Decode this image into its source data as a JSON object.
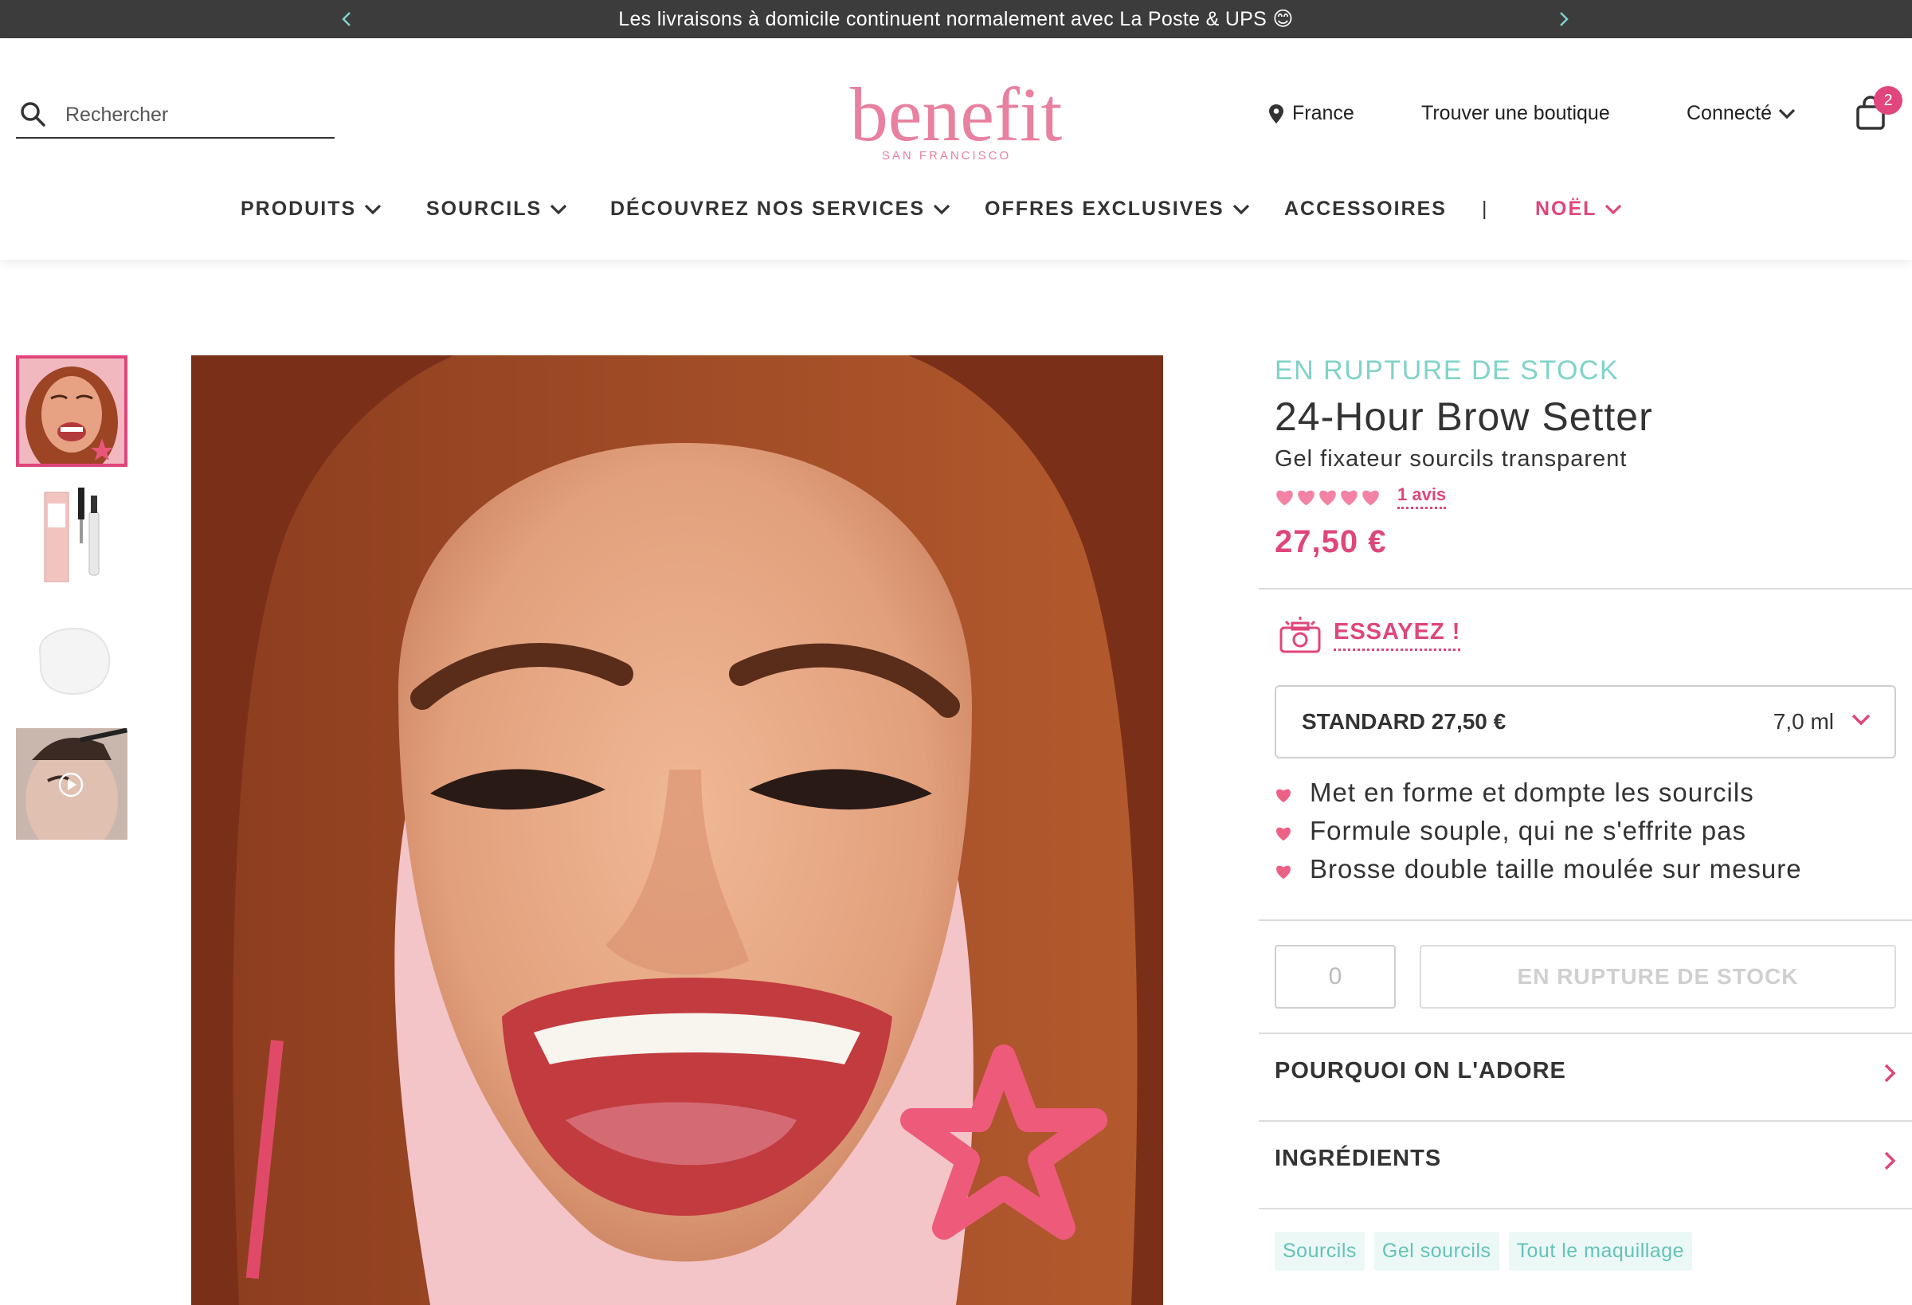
{
  "announcement": {
    "text": "Les livraisons à domicile continuent normalement avec La Poste & UPS 😊"
  },
  "header": {
    "search_placeholder": "Rechercher",
    "logo": {
      "brand": "benefit",
      "tagline": "SAN FRANCISCO"
    },
    "country": "France",
    "store_link": "Trouver une boutique",
    "account": "Connecté",
    "cart_count": "2"
  },
  "nav": {
    "items": [
      {
        "label": "PRODUITS"
      },
      {
        "label": "SOURCILS"
      },
      {
        "label": "DÉCOUVREZ NOS SERVICES"
      },
      {
        "label": "OFFRES EXCLUSIVES"
      },
      {
        "label": "ACCESSOIRES"
      },
      {
        "label": "NOËL"
      }
    ],
    "separator": "|"
  },
  "product": {
    "stock_status": "EN RUPTURE DE STOCK",
    "name": "24-Hour Brow Setter",
    "subtitle": "Gel fixateur sourcils transparent",
    "rating": 5,
    "reviews": "1 avis",
    "price": "27,50 €",
    "try_on": "ESSAYEZ !",
    "size_option": {
      "name": "STANDARD 27,50 €",
      "volume": "7,0 ml"
    },
    "benefits": [
      "Met en forme et dompte les sourcils",
      "Formule souple, qui ne s'effrite pas",
      "Brosse double taille moulée sur mesure"
    ],
    "quantity": "0",
    "add_button": "EN RUPTURE DE STOCK",
    "accordions": [
      "POURQUOI ON L'ADORE",
      "INGRÉDIENTS"
    ],
    "tags": [
      "Sourcils",
      "Gel sourcils",
      "Tout le maquillage"
    ]
  },
  "colors": {
    "brand_pink": "#e0457b",
    "teal": "#7fd3c8",
    "banner_bg": "#3c3c3c"
  }
}
